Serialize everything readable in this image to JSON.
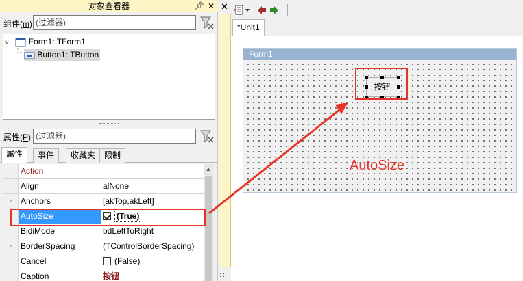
{
  "inspector": {
    "title": "对象查看器",
    "components_label_prefix": "组件(",
    "components_label_key": "m",
    "components_label_suffix": ")",
    "filter_placeholder": "(过滤器)",
    "tree": [
      {
        "label": "Form1: TForm1"
      },
      {
        "label": "Button1: TButton"
      }
    ],
    "properties_label_prefix": "属性(",
    "properties_label_key": "P",
    "properties_label_suffix": ")",
    "properties_filter_placeholder": "(过滤器)",
    "tabs": [
      "属性",
      "事件",
      "收藏夹",
      "限制"
    ],
    "grid": [
      {
        "name": "Action",
        "value": ""
      },
      {
        "name": "Align",
        "value": "alNone"
      },
      {
        "name": "Anchors",
        "value": "[akTop,akLeft]"
      },
      {
        "name": "AutoSize",
        "value": "(True)"
      },
      {
        "name": "BidiMode",
        "value": "bdLeftToRight"
      },
      {
        "name": "BorderSpacing",
        "value": "(TControlBorderSpacing)"
      },
      {
        "name": "Cancel",
        "value": "(False)"
      },
      {
        "name": "Caption",
        "value": "按钮"
      }
    ]
  },
  "designer": {
    "file_tab": "*Unit1",
    "form_caption": "Form1",
    "button_caption": "按钮"
  },
  "annotation": {
    "text": "AutoSize",
    "color": "#e8332a"
  },
  "colors": {
    "selection": "#3399ff",
    "title_bar": "#fef5c6",
    "form_caption_bar": "#99b4d1",
    "category_text": "#8a1a1a"
  }
}
